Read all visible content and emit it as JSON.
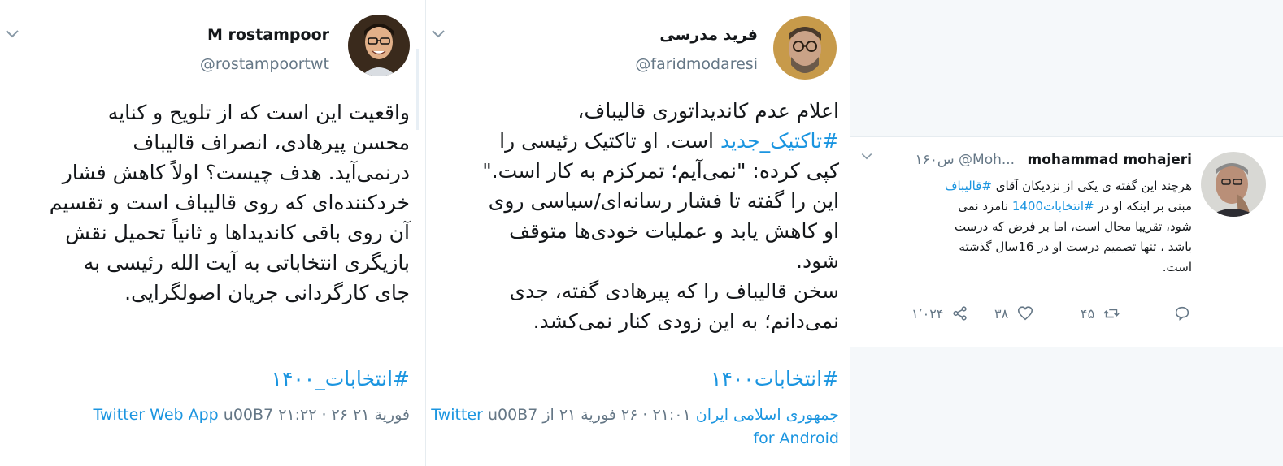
{
  "tweet_left": {
    "name": "M rostampoor",
    "handle": "@rostampoortwt",
    "lines": [
      "واقعیت این است که از تلویح و کنایه",
      "محسن پیرهادی، انصراف قالیباف",
      "درنمی‌آید. هدف چیست؟ اولاً کاهش فشار",
      "خردکننده‌ای که روی قالیباف است و تقسیم",
      "آن روی باقی کاندیداها و ثانیاً تحمیل نقش",
      "بازیگری انتخاباتی به آیت الله رئیسی به",
      "جای کارگردانی جریان اصولگرایی."
    ],
    "hashtag": "#انتخابات_۱۴۰۰",
    "time": "۲۱:۲۲ · ۲۶ فورية ۲۱",
    "sep": "u00B7",
    "source": "Twitter Web App"
  },
  "tweet_middle": {
    "name": "فرید مدرسی",
    "handle": "@faridmodaresi",
    "line1": "اعلام عدم کاندیداتوری قالیباف،",
    "line2_tag": "#تاکتیک_جدید",
    "line2_rest": " است. او تاکتیک رئیسی را",
    "lines_rest": [
      "کپی کرده: \"نمی‌آیم؛ تمرکزم به کار است.\"",
      "این را گفته تا فشار رسانه‌ای/سیاسی روی",
      "او کاهش یابد و عملیات خودی‌ها متوقف",
      "شود.",
      "سخن قالیباف را که پیرهادی گفته، جدی",
      "نمی‌دانم؛ به این زودی کنار نمی‌کشد."
    ],
    "hashtag": "#انتخابات۱۴۰۰",
    "time": "۲۱:۰۱ · ۲۶ فورية ۲۱ از",
    "location": "جمهوری اسلامی ایران",
    "sep": "u00B7",
    "source_line1": "Twitter",
    "source_line2": "for Android"
  },
  "tweet_right": {
    "name": "mohammad mohajeri",
    "handle": "@Moh...",
    "time": "۱۶۰س",
    "line1_pre": "هرچند این گفته ی یکی از نزدیکان آقای ",
    "line1_tag": "#قالیباف",
    "line2_pre": "مبنی بر اینکه او در ",
    "line2_tag": "#انتخابات1400",
    "line2_post": " نامزد نمی",
    "lines_rest": [
      "شود، تقریبا محال است، اما بر فرض که درست",
      "باشد ، تنها تصمیم درست او در 16سال گذشته",
      "است."
    ],
    "stats": {
      "replies": "",
      "retweets": "۴۵",
      "likes": "۳۸",
      "shares": "۱٬۰۲۴"
    }
  }
}
